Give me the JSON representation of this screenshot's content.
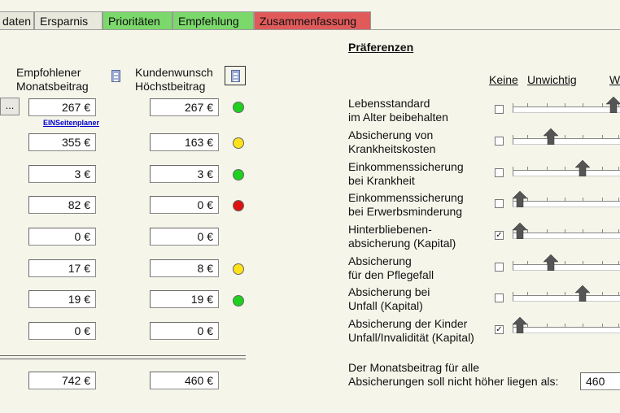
{
  "tabs": [
    {
      "label": "daten",
      "bg": "#e8e8dc"
    },
    {
      "label": "Ersparnis",
      "bg": "#e8e8dc"
    },
    {
      "label": "Prioritäten",
      "bg": "#7bd86a"
    },
    {
      "label": "Empfehlung",
      "bg": "#7bd86a"
    },
    {
      "label": "Zusammenfassung",
      "bg": "#e05a5a"
    }
  ],
  "left": {
    "col1_header_line1": "Empfohlener",
    "col1_header_line2": "Monatsbeitrag",
    "col2_header_line1": "Kundenwunsch",
    "col2_header_line2": "Höchstbeitrag",
    "more_button": "...",
    "planner_link": "EINSeitenplaner",
    "rows": [
      {
        "recommended": "267 €",
        "wish": "267 €",
        "status": "green"
      },
      {
        "recommended": "355 €",
        "wish": "163 €",
        "status": "yellow"
      },
      {
        "recommended": "3 €",
        "wish": "3 €",
        "status": "green"
      },
      {
        "recommended": "82 €",
        "wish": "0 €",
        "status": "red"
      },
      {
        "recommended": "0 €",
        "wish": "0 €",
        "status": "none"
      },
      {
        "recommended": "17 €",
        "wish": "8 €",
        "status": "yellow"
      },
      {
        "recommended": "19 €",
        "wish": "19 €",
        "status": "green"
      },
      {
        "recommended": "0 €",
        "wish": "0 €",
        "status": "none"
      }
    ],
    "total_recommended": "742 €",
    "total_wish": "460 €"
  },
  "preferences": {
    "title": "Präferenzen",
    "scale_labels": [
      "Keine",
      "Unwichtig",
      "W"
    ],
    "items": [
      {
        "line1": "Lebensstandard",
        "line2": "im Alter beibehalten",
        "checked": false,
        "level": 0.9
      },
      {
        "line1": "Absicherung von",
        "line2": "Krankheitskosten",
        "checked": false,
        "level": 0.3
      },
      {
        "line1": "Einkommenssicherung",
        "line2": "bei Krankheit",
        "checked": false,
        "level": 0.6
      },
      {
        "line1": "Einkommenssicherung",
        "line2": "bei Erwerbsminderung",
        "checked": false,
        "level": 0.0
      },
      {
        "line1": "Hinterbliebenen-",
        "line2": "absicherung (Kapital)",
        "checked": true,
        "level": 0.0
      },
      {
        "line1": "Absicherung",
        "line2": "für den Pflegefall",
        "checked": false,
        "level": 0.3
      },
      {
        "line1": "Absicherung bei",
        "line2": "Unfall (Kapital)",
        "checked": false,
        "level": 0.6
      },
      {
        "line1": "Absicherung der Kinder",
        "line2": "Unfall/Invalidität (Kapital)",
        "checked": true,
        "level": 0.0
      }
    ],
    "footer_line1": "Der Monatsbeitrag für alle",
    "footer_line2": "Absicherungen soll nicht höher liegen als:",
    "max_value": "460"
  },
  "check_mark": "✓"
}
